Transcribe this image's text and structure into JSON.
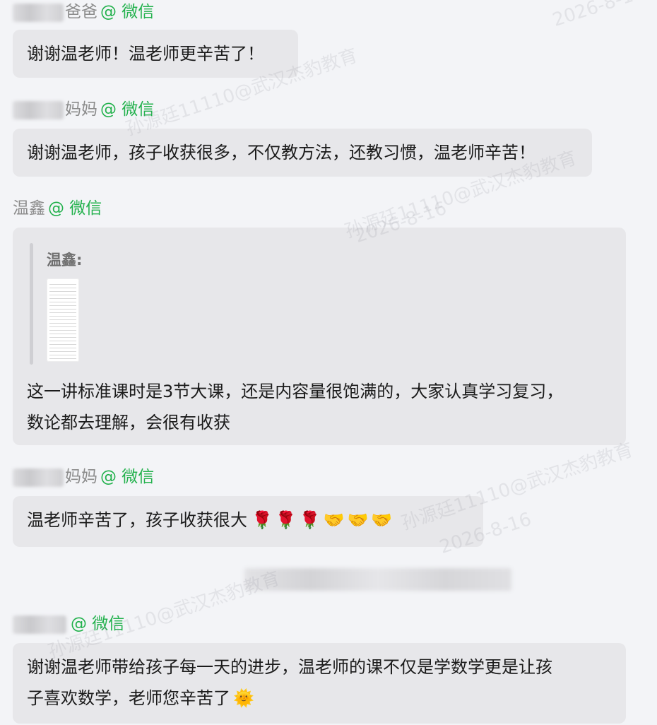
{
  "messages": [
    {
      "sender_suffix": "爸爸",
      "channel": "@ 微信",
      "text": "谢谢温老师！温老师更辛苦了！"
    },
    {
      "sender_suffix": "妈妈",
      "channel": "@ 微信",
      "text": "谢谢温老师，孩子收获很多，不仅教方法，还教习惯，温老师辛苦！"
    },
    {
      "sender": "温鑫",
      "channel": "@ 微信",
      "quote_name": "温鑫:",
      "text_line1": "这一讲标准课时是3节大课，还是内容量很饱满的，大家认真学习复习，",
      "text_line2": "数论都去理解，会很有收获"
    },
    {
      "sender_suffix": "妈妈",
      "channel": "@ 微信",
      "text": "温老师辛苦了，孩子收获很大",
      "emojis": "🌹🌹🌹🤝🤝🤝"
    },
    {
      "channel": "@ 微信",
      "text_line1": "谢谢温老师带给孩子每一天的进步，温老师的课不仅是学数学更是让孩",
      "text_line2": "子喜欢数学，老师您辛苦了",
      "emojis": "🌞"
    }
  ],
  "watermark": {
    "lines": [
      "孙源廷11110@武汉杰豹教育",
      "2026-8-16"
    ]
  },
  "icons": {
    "rose": "rose-emoji",
    "handshake": "handshake-emoji",
    "sun": "sun-with-face-emoji"
  },
  "colors": {
    "channel": "#22b14c",
    "bubble": "#e7e7ea",
    "background": "#f3f4f7"
  }
}
